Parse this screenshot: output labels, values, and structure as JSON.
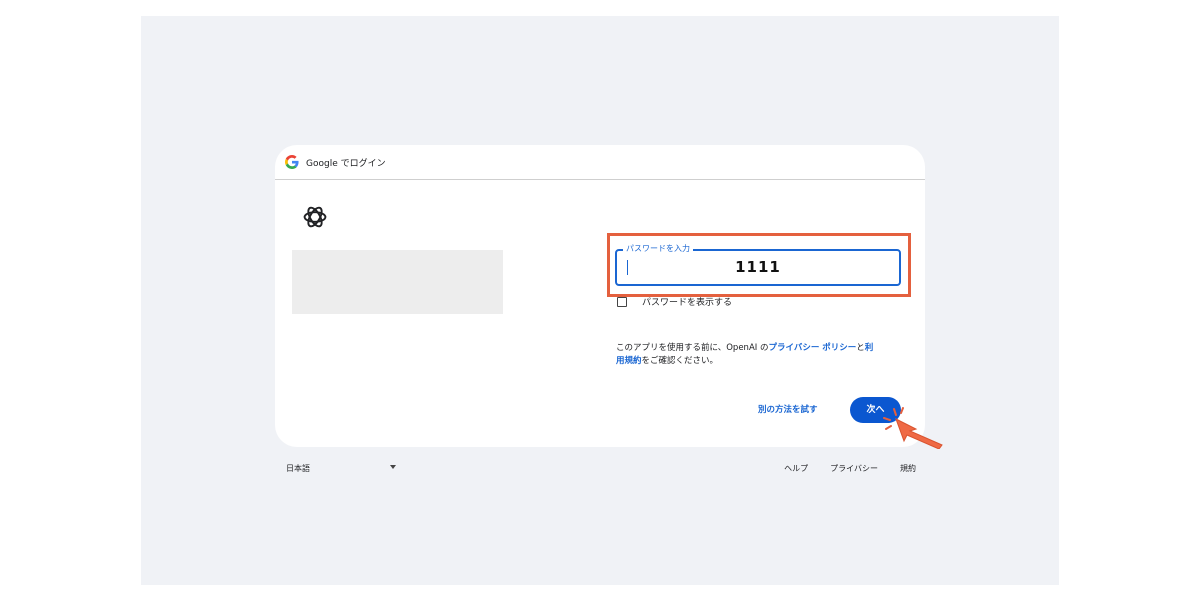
{
  "dialog": {
    "header_title": "Google でログイン",
    "password_label": "パスワードを入力",
    "password_value": "1111",
    "show_password_label": "パスワードを表示する",
    "privacy_prefix": "このアプリを使用する前に、OpenAI の",
    "privacy_link": "プライバシー ポリシー",
    "privacy_mid": "と",
    "terms_link_1": "利",
    "terms_link_2": "用規約",
    "privacy_suffix": "をご確認ください。",
    "alt_method_label": "別の方法を試す",
    "next_label": "次へ"
  },
  "footer": {
    "language": "日本語",
    "links": [
      "ヘルプ",
      "プライバシー",
      "規約"
    ]
  },
  "colors": {
    "accent": "#0b57d0",
    "highlight": "#e4603e",
    "stage_bg": "#f0f2f6"
  },
  "icons": [
    "google-g-icon",
    "openai-logo-icon",
    "checkbox-icon",
    "dropdown-caret-icon",
    "pointer-hand-icon"
  ]
}
